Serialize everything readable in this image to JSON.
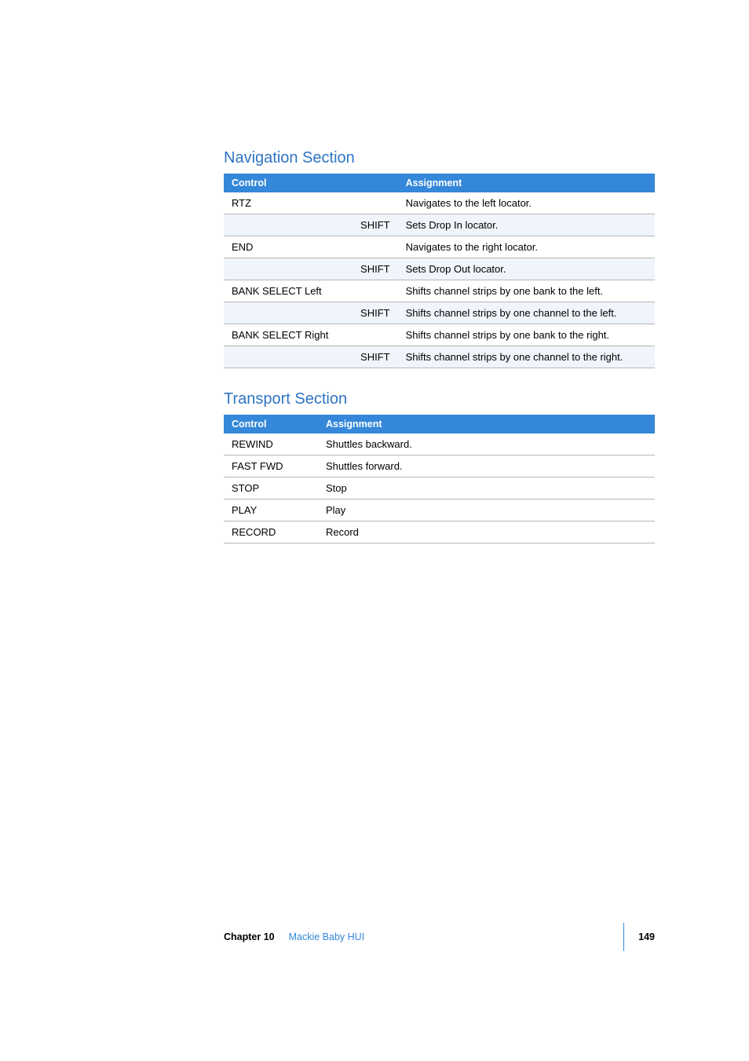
{
  "nav": {
    "heading": "Navigation Section",
    "headers": {
      "control": "Control",
      "assignment": "Assignment"
    },
    "rows": [
      {
        "control": "RTZ",
        "mod": "",
        "assignment": "Navigates to the left locator."
      },
      {
        "control": "",
        "mod": "SHIFT",
        "assignment": "Sets Drop In locator."
      },
      {
        "control": "END",
        "mod": "",
        "assignment": "Navigates to the right locator."
      },
      {
        "control": "",
        "mod": "SHIFT",
        "assignment": "Sets Drop Out locator."
      },
      {
        "control": "BANK SELECT Left",
        "mod": "",
        "assignment": "Shifts channel strips by one bank to the left."
      },
      {
        "control": "",
        "mod": "SHIFT",
        "assignment": "Shifts channel strips by one channel to the left."
      },
      {
        "control": "BANK SELECT Right",
        "mod": "",
        "assignment": "Shifts channel strips by one bank to the right."
      },
      {
        "control": "",
        "mod": "SHIFT",
        "assignment": "Shifts channel strips by one channel to the right."
      }
    ]
  },
  "transport": {
    "heading": "Transport Section",
    "headers": {
      "control": "Control",
      "assignment": "Assignment"
    },
    "rows": [
      {
        "control": "REWIND",
        "assignment": "Shuttles backward."
      },
      {
        "control": "FAST FWD",
        "assignment": "Shuttles forward."
      },
      {
        "control": "STOP",
        "assignment": "Stop"
      },
      {
        "control": "PLAY",
        "assignment": "Play"
      },
      {
        "control": "RECORD",
        "assignment": "Record"
      }
    ]
  },
  "footer": {
    "chapter": "Chapter 10",
    "title": "Mackie Baby HUI",
    "page": "149"
  }
}
